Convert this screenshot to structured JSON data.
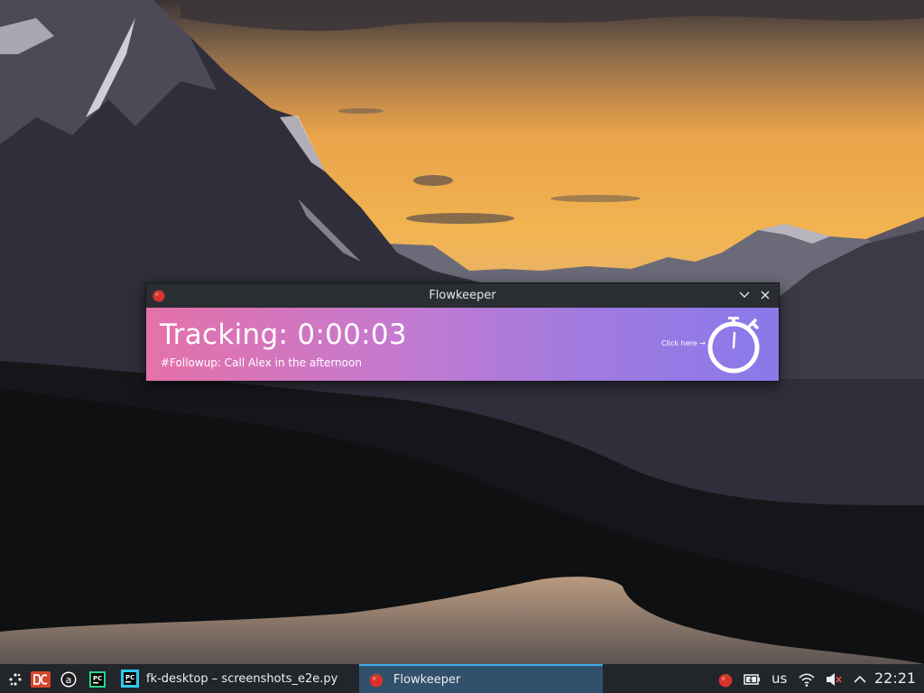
{
  "window": {
    "title": "Flowkeeper",
    "tracking_text": "Tracking: 0:00:03",
    "subtitle": "#Followup: Call Alex in the afternoon",
    "click_here": "Click here →"
  },
  "taskbar": {
    "tasks": [
      {
        "label": "fk-desktop – screenshots_e2e.py",
        "icon": "pycharm-icon"
      },
      {
        "label": "Flowkeeper",
        "icon": "tomato-icon",
        "active": true
      }
    ],
    "keyboard_layout": "us",
    "clock": "22:21",
    "launchers": [
      "app-launcher-icon",
      "double-commander-icon",
      "app-a-icon",
      "pycharm-ce-icon"
    ],
    "tray": [
      "tomato-icon",
      "battery-icon",
      "wifi-icon",
      "volume-muted-icon",
      "chevron-up-icon"
    ]
  },
  "colors": {
    "gradient_start": "#e571a9",
    "gradient_end": "#8a79ea",
    "titlebar": "#2a2e32",
    "taskbar": "#22262b",
    "active_task": "#31506b"
  }
}
